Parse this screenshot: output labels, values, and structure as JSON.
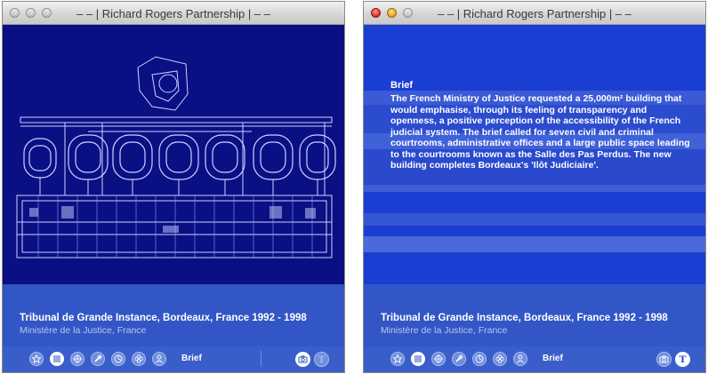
{
  "window": {
    "title": "– – | Richard Rogers Partnership | – –"
  },
  "project": {
    "title": "Tribunal de Grande Instance, Bordeaux, France  1992 - 1998",
    "client": "Ministère de la Justice, France"
  },
  "toolbar": {
    "section_label": "Brief",
    "icons": [
      "star-icon",
      "list-icon",
      "crosshair-icon",
      "pencil-icon",
      "chart-icon",
      "flower-icon",
      "people-icon"
    ]
  },
  "brief": {
    "heading": "Brief",
    "body": "The French Ministry of Justice requested a 25,000m² building that would emphasise, through its feeling of transparency and openness, a positive perception of the accessibility of the French judicial system. The brief called for seven civil and criminal courtrooms, administrative offices and a large public space leading to the courtrooms known as the Salle des Pas Perdus. The new building completes Bordeaux's 'Ilôt Judiciaire'."
  },
  "colors": {
    "window_bg": "#0a0f84",
    "caption_bg": "#3256c6",
    "brief_bg": "#1a3ed2",
    "drawing_line": "#c9d2ff"
  }
}
